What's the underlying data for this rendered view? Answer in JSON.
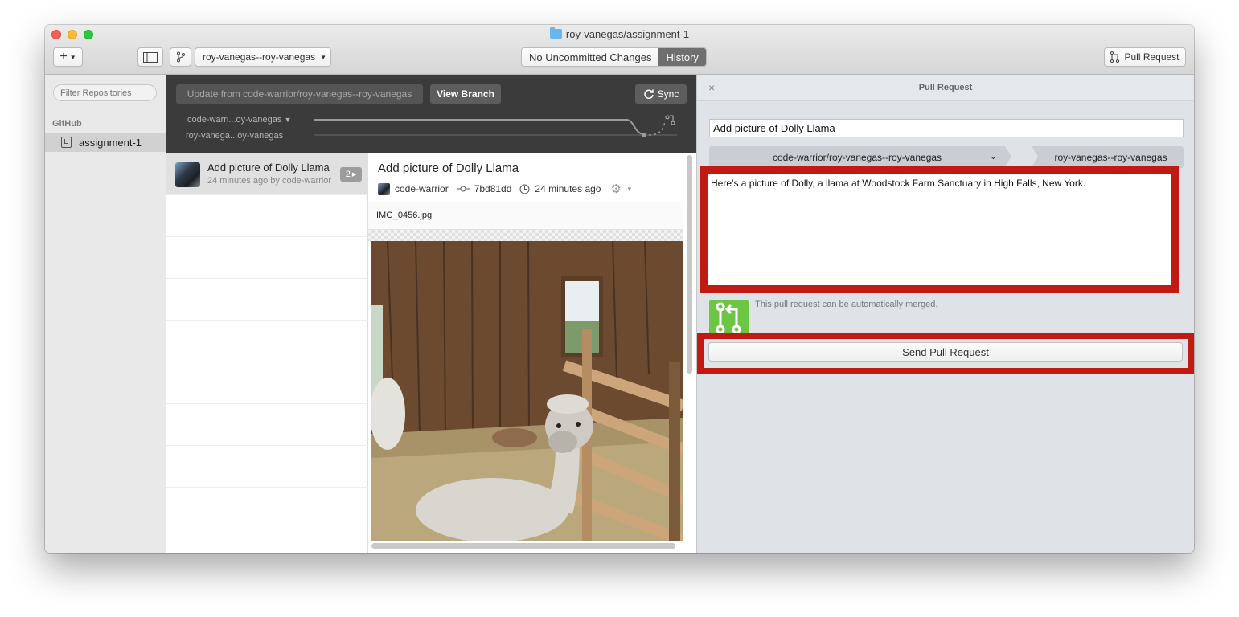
{
  "window": {
    "title": "roy-vanegas/assignment-1"
  },
  "toolbar": {
    "add_label": "+",
    "branch_select": "roy-vanegas--roy-vanegas",
    "tabs": [
      {
        "label": "No Uncommitted Changes",
        "selected": false
      },
      {
        "label": "History",
        "selected": true
      }
    ],
    "pull_request_label": "Pull Request"
  },
  "sidebar": {
    "filter_placeholder": "Filter Repositories",
    "section": "GitHub",
    "items": [
      {
        "label": "assignment-1",
        "selected": true
      }
    ]
  },
  "branch_header": {
    "update_label": "Update from code-warrior/roy-vanegas--roy-vanegas",
    "view_branch_label": "View Branch",
    "sync_label": "Sync",
    "branch_a": "code-warri...oy-vanegas",
    "branch_b": "roy-vanega...oy-vanegas"
  },
  "commits": [
    {
      "title": "Add picture of Dolly Llama",
      "subtitle": "24 minutes ago by code-warrior",
      "count": "2"
    }
  ],
  "detail": {
    "title": "Add picture of Dolly Llama",
    "author": "code-warrior",
    "sha": "7bd81dd",
    "time": "24 minutes ago",
    "file": "IMG_0456.jpg"
  },
  "pull_request": {
    "heading": "Pull Request",
    "close": "×",
    "title_value": "Add picture of Dolly Llama",
    "base_branch": "code-warrior/roy-vanegas--roy-vanegas",
    "head_branch": "roy-vanegas--roy-vanegas",
    "description": "Here’s a picture of Dolly, a llama at Woodstock Farm Sanctuary in High Falls, New York.",
    "merge_status": "This pull request can be automatically merged.",
    "send_label": "Send Pull Request"
  },
  "colors": {
    "highlight": "#c11a12",
    "merge_green": "#6cc644"
  }
}
